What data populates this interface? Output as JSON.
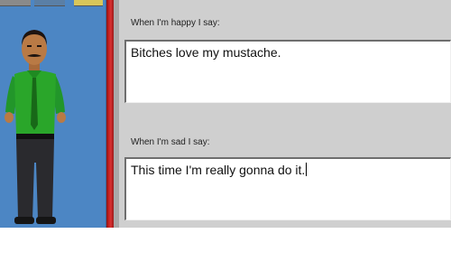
{
  "window": {
    "colors": {
      "background": "#c6c6c6",
      "left_panel": "#4c86c4",
      "divider": "#c82222",
      "field": "#ffffff"
    },
    "toolbar_swatches": [
      "#8a8a8a",
      "#5a7fa6",
      "#d8c65a"
    ]
  },
  "character": {
    "icon": "man-with-mustache-figure",
    "shirt_color": "#2aa62a",
    "tie_color": "#186818",
    "pants_color": "#2a2a2e"
  },
  "form": {
    "happy_prompt": "When I'm happy I say:",
    "happy_text": "Bitches love my mustache.",
    "sad_prompt": "When I'm sad I say:",
    "sad_text": "This time I'm really gonna do it."
  }
}
